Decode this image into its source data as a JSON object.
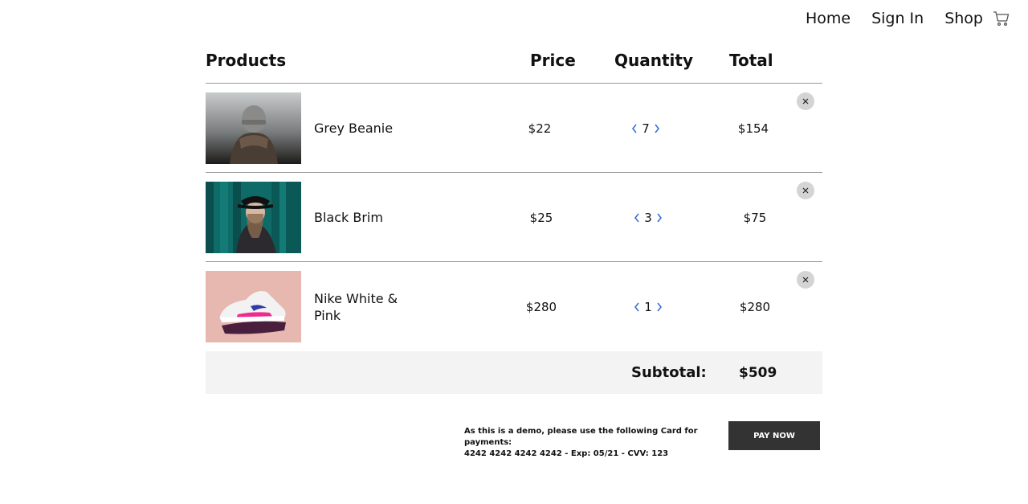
{
  "nav": {
    "items": [
      {
        "label": "Home"
      },
      {
        "label": "Sign In"
      },
      {
        "label": "Shop"
      }
    ],
    "cart_icon": "shopping-cart-icon"
  },
  "cart": {
    "headers": {
      "products": "Products",
      "price": "Price",
      "quantity": "Quantity",
      "total": "Total"
    },
    "items": [
      {
        "name": "Grey Beanie",
        "price": "$22",
        "quantity": "7",
        "total": "$154"
      },
      {
        "name": "Black Brim",
        "price": "$25",
        "quantity": "3",
        "total": "$75"
      },
      {
        "name": "Nike White & Pink",
        "price": "$280",
        "quantity": "1",
        "total": "$280"
      }
    ],
    "subtotal_label": "Subtotal:",
    "subtotal_value": "$509"
  },
  "payment": {
    "note_line1": "As this is a demo, please use the following Card for payments:",
    "note_line2": "4242 4242 4242 4242 - Exp: 05/21 - CVV: 123",
    "pay_label": "PAY NOW"
  },
  "colors": {
    "accent_chevron": "#3b6fd6",
    "pay_button": "#333333",
    "subtotal_bg": "#f3f3f3",
    "remove_bg": "#d4d4d4"
  }
}
